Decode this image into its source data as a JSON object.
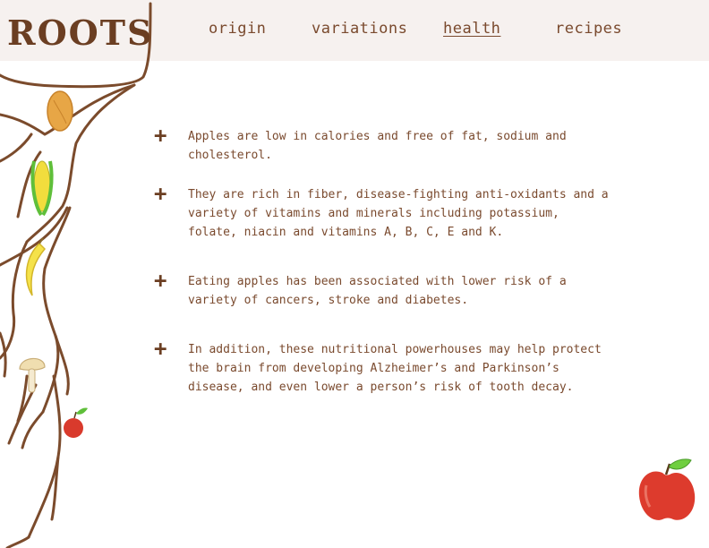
{
  "logo": {
    "text": "ROOTS"
  },
  "nav": {
    "items": [
      {
        "label": "origin"
      },
      {
        "label": "variations"
      },
      {
        "label": "health",
        "active": true
      },
      {
        "label": "recipes"
      }
    ]
  },
  "content": {
    "bullets": [
      {
        "text": "Apples are low in calories and free of fat, sodium and cholesterol."
      },
      {
        "text": "They are rich in fiber, disease-fighting anti-oxidants and a variety of vitamins and minerals including potassium, folate, niacin and vitamins A, B, C, E and K."
      },
      {
        "text": "Eating apples has been associated with lower risk of a variety of cancers, stroke and diabetes."
      },
      {
        "text": "In addition, these nutritional powerhouses may help protect the brain from developing Alzheimer’s and Parkinson’s disease, and even lower a person’s risk of tooth decay."
      }
    ]
  },
  "colors": {
    "brown": "#7a4a2e",
    "topbar": "#f6f1ef"
  },
  "icons": [
    "almond-icon",
    "corn-icon",
    "banana-icon",
    "mushroom-icon",
    "small-apple-icon",
    "apple-icon"
  ]
}
